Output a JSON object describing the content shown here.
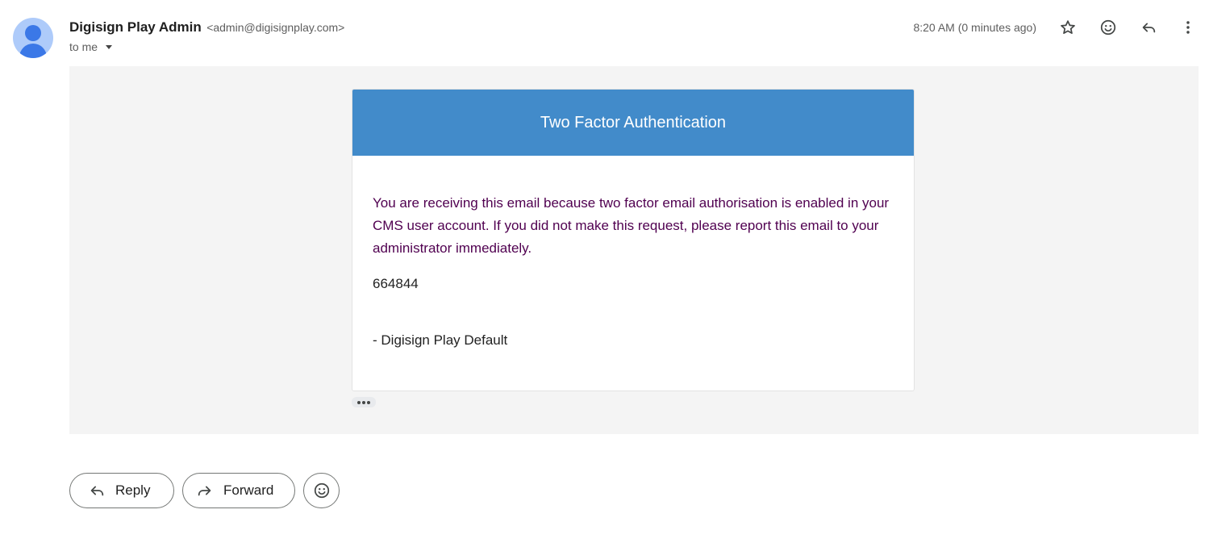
{
  "sender": {
    "name": "Digisign Play Admin",
    "email": "<admin@digisignplay.com>",
    "recipient_label": "to me"
  },
  "header": {
    "timestamp": "8:20 AM (0 minutes ago)",
    "icons": [
      "star-icon",
      "emoji-reaction-icon",
      "reply-icon",
      "more-options-icon"
    ]
  },
  "email": {
    "card_title": "Two Factor Authentication",
    "message": "You are receiving this email because two factor email authorisation is enabled in your CMS user account. If you did not make this request, please report this email to your administrator immediately.",
    "code": "664844",
    "signature": "- Digisign Play Default",
    "header_color": "#428bca",
    "message_color": "#500050"
  },
  "actions": {
    "reply_label": "Reply",
    "forward_label": "Forward"
  }
}
